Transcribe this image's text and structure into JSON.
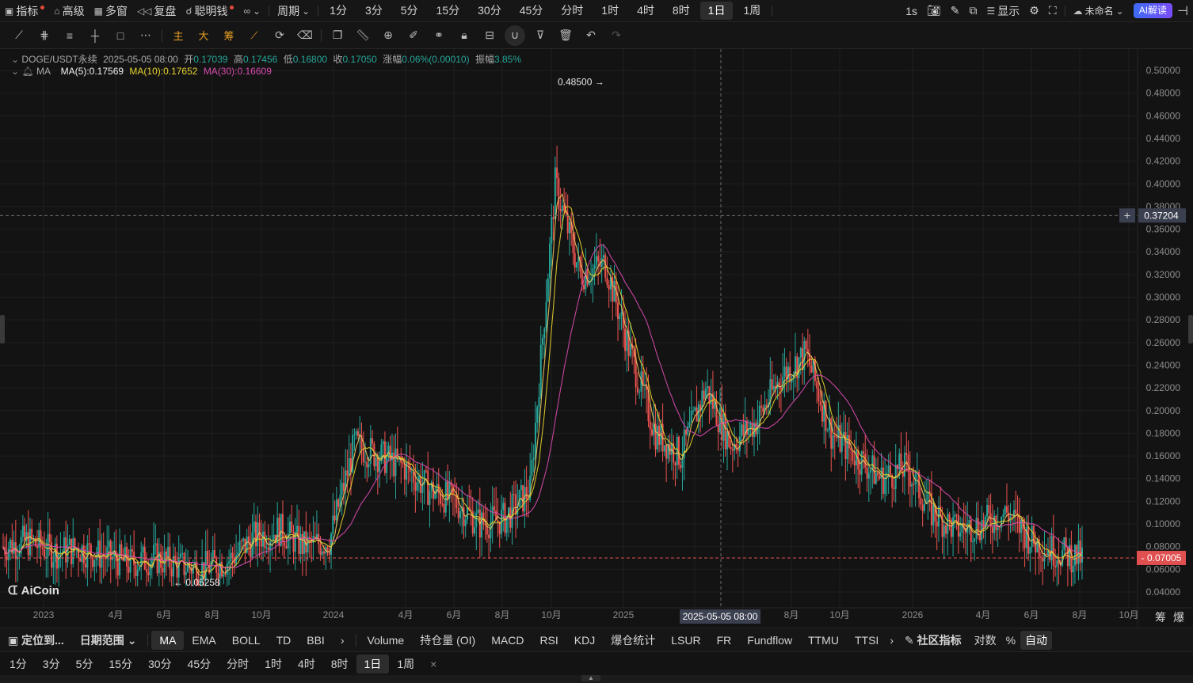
{
  "topbar": {
    "indicators": "指标",
    "advanced": "高级",
    "multi_window": "多窗",
    "replay": "复盘",
    "smart_money": "聪明钱",
    "period": "周期",
    "timeframes": [
      "1分",
      "3分",
      "5分",
      "15分",
      "30分",
      "45分",
      "分时",
      "1时",
      "4时",
      "8时",
      "1日",
      "1周"
    ],
    "active_timeframe": "1日",
    "interval": "1s",
    "display": "显示",
    "layout_name": "未命名",
    "ai_button": "AI解读"
  },
  "drawbar": {
    "main_label": "主",
    "big_label": "大",
    "chips_label": "筹"
  },
  "legend": {
    "symbol": "DOGE/USDT永续",
    "datetime": "2025-05-05 08:00",
    "open_label": "开",
    "open": "0.17039",
    "high_label": "高",
    "high": "0.17456",
    "low_label": "低",
    "low": "0.16800",
    "close_label": "收",
    "close": "0.17050",
    "change_label": "涨幅",
    "change": "0.06%(0.00010)",
    "amplitude_label": "振幅",
    "amplitude": "3.85%",
    "ma_name": "MA",
    "ma5": "MA(5):0.17569",
    "ma10": "MA(10):0.17652",
    "ma30": "MA(30):0.16609"
  },
  "chart_annotations": {
    "high_marker": "0.48500 →",
    "low_marker": "← 0.05258",
    "crosshair_price": "0.37204",
    "current_price": "0.07005",
    "crosshair_date": "2025-05-05 08:00",
    "watermark": "AiCoin",
    "chips_toggle": "筹",
    "burst_toggle": "爆"
  },
  "colors": {
    "up": "#26a69a",
    "down": "#ef5350",
    "ma5": "#f0c75e",
    "ma10": "#e6d22d",
    "ma30": "#d94bb0",
    "current_price_bg": "#e05050",
    "crosshair_bg": "#3b4050"
  },
  "chart_data": {
    "type": "candlestick",
    "title": "DOGE/USDT永续",
    "y_ticks": [
      "0.50000",
      "0.48000",
      "0.46000",
      "0.44000",
      "0.42000",
      "0.40000",
      "0.38000",
      "0.36000",
      "0.34000",
      "0.32000",
      "0.30000",
      "0.28000",
      "0.26000",
      "0.24000",
      "0.22000",
      "0.20000",
      "0.18000",
      "0.16000",
      "0.14000",
      "0.12000",
      "0.10000",
      "0.08000",
      "0.06000",
      "0.04000"
    ],
    "x_ticks": [
      "2023",
      "4月",
      "6月",
      "8月",
      "10月",
      "2024",
      "4月",
      "6月",
      "8月",
      "10月",
      "2025",
      "4月",
      "6月",
      "8月",
      "10月",
      "2026",
      "4月",
      "6月",
      "8月",
      "10月"
    ],
    "ylim": [
      0.03,
      0.51
    ],
    "price_path": {
      "x": [
        "2023-01",
        "2023-02",
        "2023-03",
        "2023-04",
        "2023-05",
        "2023-06",
        "2023-07",
        "2023-08",
        "2023-09",
        "2023-10",
        "2023-11",
        "2023-12",
        "2024-01",
        "2024-02",
        "2024-03",
        "2024-04",
        "2024-05",
        "2024-06",
        "2024-07",
        "2024-08",
        "2024-09",
        "2024-10",
        "2024-11",
        "2024-12",
        "2025-01",
        "2025-02",
        "2025-03",
        "2025-04",
        "2025-05",
        "2025-06",
        "2025-07",
        "2025-08",
        "2025-09",
        "2025-10",
        "2025-11",
        "2025-12",
        "2026-01",
        "2026-02",
        "2026-03",
        "2026-04",
        "2026-05",
        "2026-06",
        "2026-07",
        "2026-08"
      ],
      "close": [
        0.08,
        0.085,
        0.075,
        0.078,
        0.072,
        0.065,
        0.07,
        0.063,
        0.061,
        0.068,
        0.088,
        0.095,
        0.08,
        0.085,
        0.17,
        0.16,
        0.15,
        0.13,
        0.12,
        0.1,
        0.105,
        0.13,
        0.4,
        0.32,
        0.33,
        0.25,
        0.18,
        0.16,
        0.22,
        0.17,
        0.19,
        0.23,
        0.25,
        0.18,
        0.16,
        0.14,
        0.15,
        0.11,
        0.095,
        0.1,
        0.11,
        0.085,
        0.075,
        0.07
      ]
    },
    "ma_series": [
      {
        "name": "MA(5)",
        "last": 0.17569
      },
      {
        "name": "MA(10)",
        "last": 0.17652
      },
      {
        "name": "MA(30)",
        "last": 0.16609
      }
    ]
  },
  "bottom_indicators": {
    "locate": "定位到...",
    "date_range": "日期范围",
    "main_indicators": [
      "MA",
      "EMA",
      "BOLL",
      "TD",
      "BBI"
    ],
    "active_main": "MA",
    "sub_indicators": [
      "Volume",
      "持仓量 (OI)",
      "MACD",
      "RSI",
      "KDJ",
      "爆仓统计",
      "LSUR",
      "FR",
      "Fundflow",
      "TTMU",
      "TTSI"
    ],
    "community": "社区指标",
    "log_scale": "对数",
    "percent": "%",
    "auto": "自动"
  },
  "bottom_timeframes": {
    "items": [
      "1分",
      "3分",
      "5分",
      "15分",
      "30分",
      "45分",
      "分时",
      "1时",
      "4时",
      "8时",
      "1日",
      "1周"
    ],
    "active": "1日",
    "close": "×"
  }
}
